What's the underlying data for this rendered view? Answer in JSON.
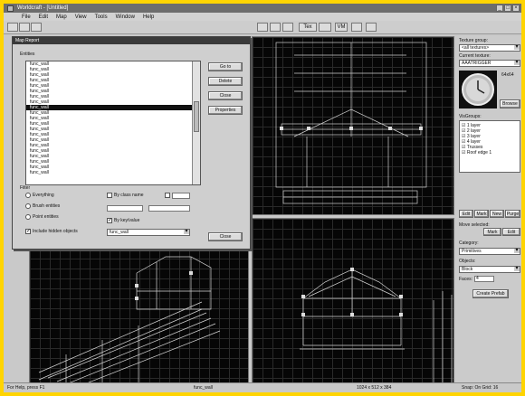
{
  "window": {
    "title": "Worldcraft - [Untitled]"
  },
  "menu": [
    "File",
    "Edit",
    "Map",
    "View",
    "Tools",
    "Window",
    "Help"
  ],
  "toolbar": {
    "btn_a": "Tex",
    "btn_b": "VM"
  },
  "dialog": {
    "title": "Map Report",
    "objects_label": "Entities",
    "objects": [
      "func_wall",
      "func_wall",
      "func_wall",
      "func_wall",
      "func_wall",
      "func_wall",
      "func_wall",
      "func_wall",
      "func_wall",
      "func_wall",
      "func_wall",
      "func_wall",
      "func_wall",
      "func_wall",
      "func_wall",
      "func_wall",
      "func_wall",
      "func_wall",
      "func_wall",
      "func_wall",
      "func_wall"
    ],
    "selected_index": 8,
    "buttons": {
      "go_to": "Go to",
      "delete": "Delete",
      "properties": "Properties",
      "close": "Close",
      "close2": "Close"
    },
    "filter_label": "Filter",
    "opt1": "Everything",
    "opt2": "Brush entities",
    "opt3": "Point entities",
    "opt4": "Include hidden objects",
    "opt5": "By class name",
    "opt6": "Exact",
    "opt7": "By key/value",
    "class_value": "func_wall"
  },
  "right": {
    "texture_group_label": "Texture group:",
    "texture_group": "<all textures>",
    "current_texture_label": "Current texture:",
    "current_texture": "AAATRIGGER",
    "size_label": "64x64",
    "browse": "Browse",
    "visgroups_label": "VisGroups:",
    "visgroups": [
      "1 layer",
      "2 layer",
      "3 layer",
      "4 layer",
      "Trusses",
      "Roof edge 1"
    ],
    "tabs": [
      "Edit",
      "Mark",
      "New",
      "Purge"
    ],
    "move_label": "Move selected:",
    "btn_mark": "Mark",
    "btn_edit": "Edit",
    "category_label": "Category:",
    "category": "Primitives",
    "objects_label": "Objects:",
    "objects": "Block",
    "faces_label": "Faces:",
    "faces_value": "4",
    "create_btn": "Create Prefab"
  },
  "status": {
    "left": "For Help, press F1",
    "mid": "func_wall",
    "mid2": "1024 x 512 x 384",
    "right": "Snap: On Grid: 16"
  }
}
